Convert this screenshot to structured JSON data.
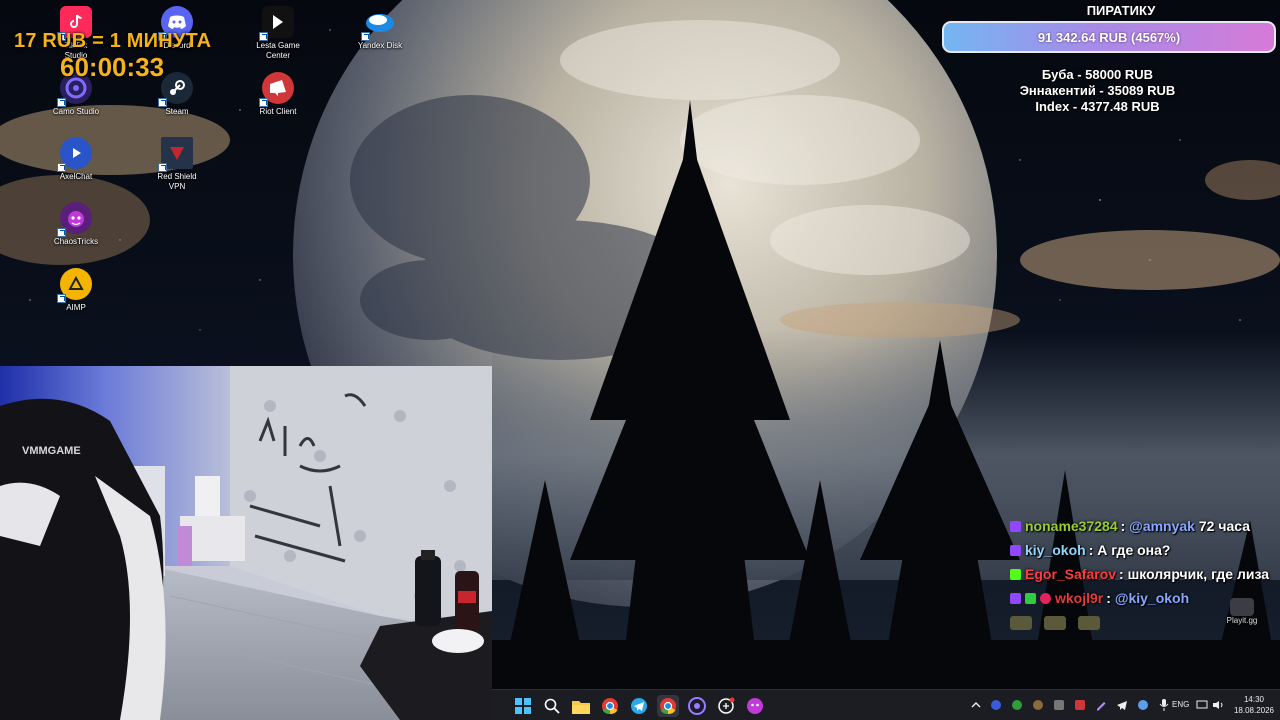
{
  "desktop": {
    "icons": [
      {
        "label": "TikTok\nStudio",
        "icon": "tiktok-icon",
        "color": "#ff2a5a"
      },
      {
        "label": "Discord",
        "icon": "discord-icon",
        "color": "#5865f2"
      },
      {
        "label": "Lesta Game\nCenter",
        "icon": "lesta-icon",
        "color": "#111111"
      },
      {
        "label": "Yandex Disk",
        "icon": "yandex-disk-icon",
        "color": "#1e88e5"
      },
      {
        "label": "Camo Studio",
        "icon": "camo-icon",
        "color": "#3b2a7a"
      },
      {
        "label": "Steam",
        "icon": "steam-icon",
        "color": "#1b2838"
      },
      {
        "label": "Riot Client",
        "icon": "riot-icon",
        "color": "#d13639"
      },
      {
        "label": "AxelChat",
        "icon": "axelchat-icon",
        "color": "#2a55c8"
      },
      {
        "label": "Red Shield\nVPN",
        "icon": "shield-icon",
        "color": "#c4262e"
      },
      {
        "label": "ChaosTricks",
        "icon": "chaostricks-icon",
        "color": "#7a2a9c"
      },
      {
        "label": "AIMP",
        "icon": "aimp-icon",
        "color": "#f4b400"
      }
    ],
    "playgg_label": "Playit.gg"
  },
  "overlay": {
    "rate_text": "17 RUB = 1 МИНУТА",
    "timer": "60:00:33",
    "goal_title": "ПИРАТИКУ",
    "goal_amount": "91 342.64 RUB (4567%)",
    "donors": [
      "Буба - 58000 RUB",
      "Эннакентий - 35089 RUB",
      "Index - 4377.48 RUB"
    ],
    "accent": "#f5b21b"
  },
  "chat": {
    "messages": [
      {
        "user": "noname37284",
        "user_color": "#9acd32",
        "badges": [
          "#9146ff"
        ],
        "text": ": @amnyak 72 часа",
        "mention": "@amnyak",
        "mention_color": "#88a8ff"
      },
      {
        "user": "kiy_okoh",
        "user_color": "#8fd6ff",
        "badges": [
          "#9146ff"
        ],
        "text": ": А где она?"
      },
      {
        "user": "Egor_Safarov",
        "user_color": "#ff3b3b",
        "badges": [
          "#53fc18"
        ],
        "text": ": школярчик, где лиза"
      },
      {
        "user": "wkojl9r",
        "user_color": "#e23b3b",
        "badges": [
          "#9146ff",
          "#2ecc40",
          "#e0245e"
        ],
        "text": ": @kiy_okoh",
        "mention": "@kiy_okoh",
        "mention_color": "#88a8ff"
      }
    ]
  },
  "taskbar": {
    "apps": [
      "windows-start-icon",
      "search-icon",
      "file-explorer-icon",
      "chrome-icon",
      "telegram-icon",
      "chrome-active-icon",
      "obs-icon",
      "chatgpt-icon",
      "chaostricks-icon"
    ],
    "tray": [
      "chevron-up-icon",
      "tray-app-icon",
      "xbox-icon",
      "tray-app-icon",
      "tray-app-icon",
      "riot-tray-icon",
      "pen-icon",
      "telegram-tray-icon",
      "tray-app-icon",
      "mic-icon"
    ],
    "language": "ENG",
    "time": "14:30",
    "date": "18.08.2026"
  }
}
